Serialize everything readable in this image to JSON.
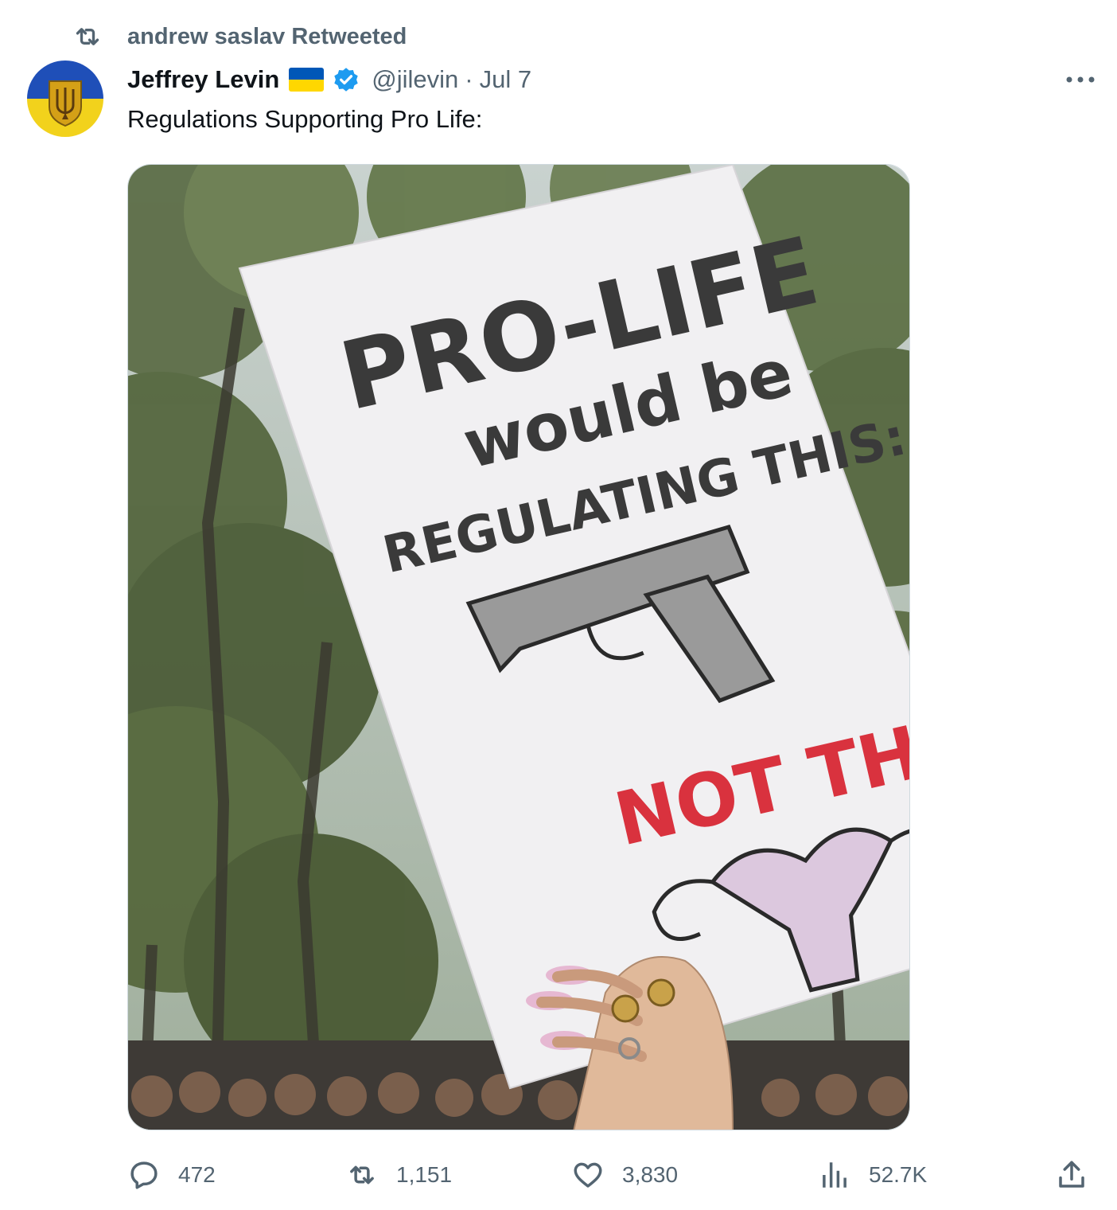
{
  "retweet_banner": {
    "label": "andrew saslav Retweeted",
    "icon": "retweet-icon"
  },
  "author": {
    "display_name": "Jeffrey Levin",
    "flag_icon": "ukraine-flag-icon",
    "verified_icon": "verified-badge-icon",
    "handle": "@jilevin",
    "separator": "·",
    "date": "Jul 7",
    "avatar_icon": "ukraine-trident-avatar"
  },
  "more_icon": "more-options-icon",
  "tweet": {
    "text": "Regulations Supporting Pro Life:"
  },
  "media": {
    "kind": "photo",
    "sign_text": {
      "line1": "PRO-LIFE",
      "line2": "would be",
      "line3": "REGULATING THIS:",
      "line4": "NOT THIS:"
    }
  },
  "actions": {
    "reply": {
      "icon": "reply-icon",
      "count": "472"
    },
    "retweet": {
      "icon": "retweet-icon",
      "count": "1,151"
    },
    "like": {
      "icon": "heart-icon",
      "count": "3,830"
    },
    "views": {
      "icon": "views-chart-icon",
      "count": "52.7K"
    },
    "share": {
      "icon": "share-icon"
    }
  },
  "colors": {
    "text_primary": "#0f1419",
    "text_secondary": "#536471",
    "verified_blue": "#1d9bf0",
    "ukraine_blue": "#0057b7",
    "ukraine_yellow": "#ffd700",
    "sign_red": "#d9323e"
  }
}
